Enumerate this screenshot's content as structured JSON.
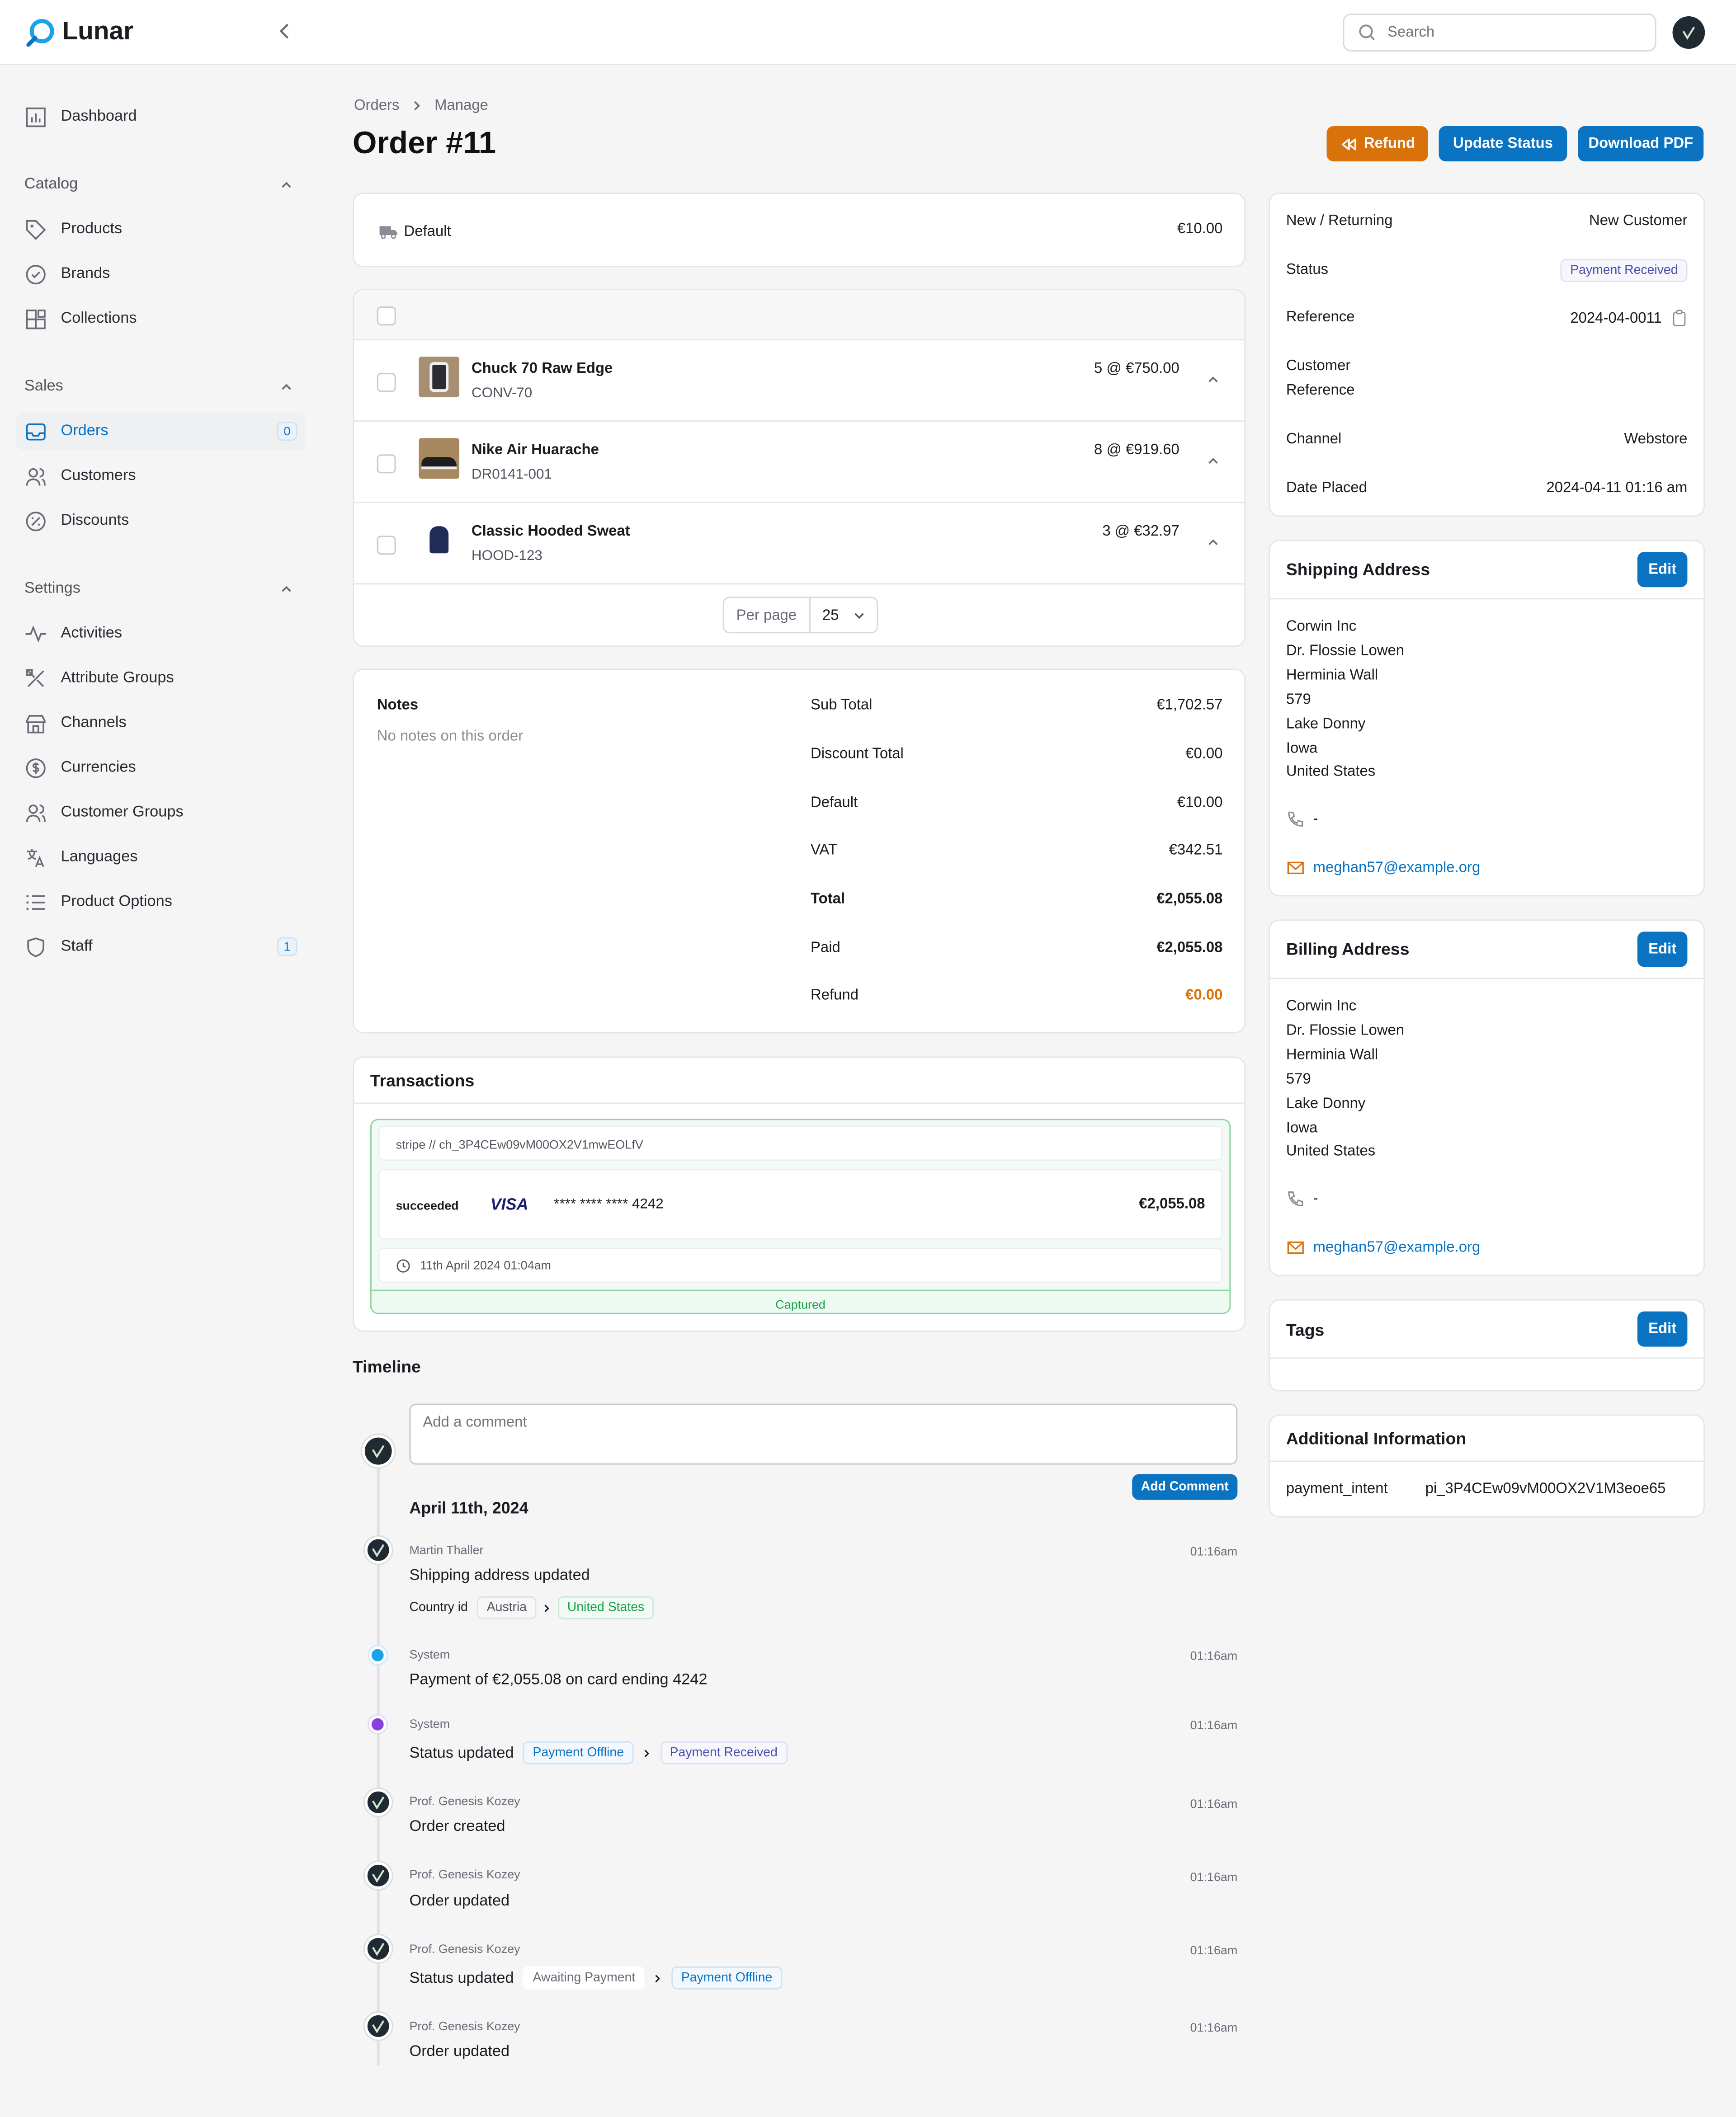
{
  "app": {
    "name": "Lunar"
  },
  "search": {
    "placeholder": "Search"
  },
  "sidebar": {
    "dashboard": "Dashboard",
    "catalog": {
      "title": "Catalog",
      "items": [
        "Products",
        "Brands",
        "Collections"
      ]
    },
    "sales": {
      "title": "Sales",
      "items": [
        "Orders",
        "Customers",
        "Discounts"
      ],
      "orders_count": "0"
    },
    "settings": {
      "title": "Settings",
      "items": [
        "Activities",
        "Attribute Groups",
        "Channels",
        "Currencies",
        "Customer Groups",
        "Languages",
        "Product Options",
        "Staff"
      ],
      "staff_count": "1"
    }
  },
  "breadcrumb": {
    "parent": "Orders",
    "current": "Manage"
  },
  "page_title": "Order #11",
  "actions": {
    "refund": "Refund",
    "update_status": "Update Status",
    "download_pdf": "Download PDF"
  },
  "shipping_method": {
    "name": "Default",
    "price": "€10.00"
  },
  "lines": [
    {
      "name": "Chuck 70 Raw Edge",
      "sku": "CONV-70",
      "qty_price": "5 @ €750.00"
    },
    {
      "name": "Nike Air Huarache",
      "sku": "DR0141-001",
      "qty_price": "8 @ €919.60"
    },
    {
      "name": "Classic Hooded Sweat",
      "sku": "HOOD-123",
      "qty_price": "3 @ €32.97"
    }
  ],
  "pagination": {
    "label": "Per page",
    "value": "25"
  },
  "notes": {
    "title": "Notes",
    "empty": "No notes on this order"
  },
  "summary": {
    "sub_total_label": "Sub Total",
    "sub_total": "€1,702.57",
    "discount_label": "Discount Total",
    "discount": "€0.00",
    "shipping_label": "Default",
    "shipping": "€10.00",
    "vat_label": "VAT",
    "vat": "€342.51",
    "total_label": "Total",
    "total": "€2,055.08",
    "paid_label": "Paid",
    "paid": "€2,055.08",
    "refund_label": "Refund",
    "refund": "€0.00"
  },
  "transactions": {
    "title": "Transactions",
    "reference": "stripe // ch_3P4CEw09vM00OX2V1mwEOLfV",
    "status": "succeeded",
    "card_brand": "VISA",
    "card_number": "**** **** **** 4242",
    "amount": "€2,055.08",
    "date": "11th April 2024 01:04am",
    "state": "Captured"
  },
  "timeline": {
    "title": "Timeline",
    "comment_placeholder": "Add a comment",
    "add_comment": "Add Comment",
    "date_heading": "April 11th, 2024",
    "events": [
      {
        "author": "Martin Thaller",
        "time": "01:16am",
        "text": "Shipping address updated",
        "field": "Country id",
        "from": "Austria",
        "to": "United States"
      },
      {
        "author": "System",
        "time": "01:16am",
        "text": "Payment of €2,055.08 on card ending 4242"
      },
      {
        "author": "System",
        "time": "01:16am",
        "text": "Status updated",
        "from": "Payment Offline",
        "to": "Payment Received"
      },
      {
        "author": "Prof. Genesis Kozey",
        "time": "01:16am",
        "text": "Order created"
      },
      {
        "author": "Prof. Genesis Kozey",
        "time": "01:16am",
        "text": "Order updated"
      },
      {
        "author": "Prof. Genesis Kozey",
        "time": "01:16am",
        "text": "Status updated",
        "from": "Awaiting Payment",
        "to": "Payment Offline"
      },
      {
        "author": "Prof. Genesis Kozey",
        "time": "01:16am",
        "text": "Order updated"
      }
    ]
  },
  "details": {
    "new_returning_label": "New / Returning",
    "new_returning": "New Customer",
    "status_label": "Status",
    "status": "Payment Received",
    "reference_label": "Reference",
    "reference": "2024-04-0011",
    "customer_ref_label_1": "Customer",
    "customer_ref_label_2": "Reference",
    "channel_label": "Channel",
    "channel": "Webstore",
    "date_label": "Date Placed",
    "date": "2024-04-11 01:16 am"
  },
  "shipping_address": {
    "title": "Shipping Address",
    "edit": "Edit",
    "lines": [
      "Corwin Inc",
      "Dr. Flossie Lowen",
      "Herminia Wall",
      "579",
      "Lake Donny",
      "Iowa",
      "United States"
    ],
    "phone": "-",
    "email": "meghan57@example.org"
  },
  "billing_address": {
    "title": "Billing Address",
    "edit": "Edit",
    "lines": [
      "Corwin Inc",
      "Dr. Flossie Lowen",
      "Herminia Wall",
      "579",
      "Lake Donny",
      "Iowa",
      "United States"
    ],
    "phone": "-",
    "email": "meghan57@example.org"
  },
  "tags": {
    "title": "Tags",
    "edit": "Edit"
  },
  "additional": {
    "title": "Additional Information",
    "key": "payment_intent",
    "value": "pi_3P4CEw09vM00OX2V1M3eoe65"
  },
  "colors": {
    "primary": "#0a73c2",
    "refund": "#d9720b",
    "success": "#16a34a",
    "purple": "#8b3fe0",
    "blue_dot": "#1aa3e8"
  }
}
